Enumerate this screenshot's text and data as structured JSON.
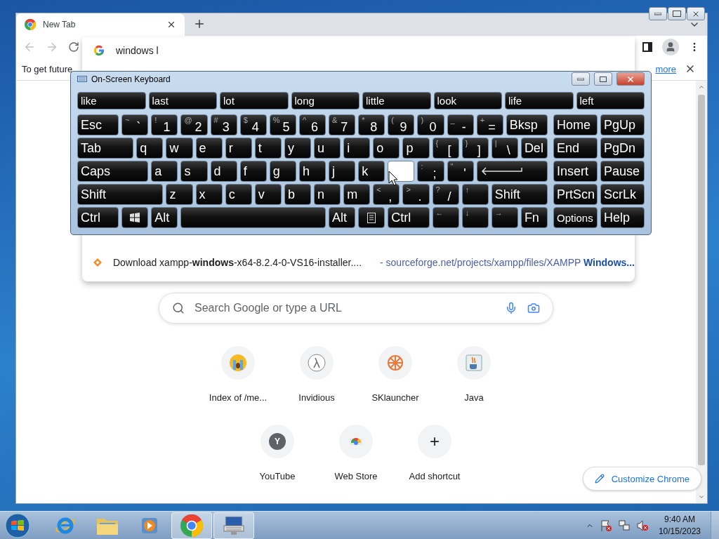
{
  "browser": {
    "tab": {
      "title": "New Tab",
      "selected": true
    },
    "omnibox": {
      "value": "windows l"
    },
    "infobar": {
      "text": "To get future",
      "link": "more"
    },
    "suggestions": [
      {
        "text": "Download xampp-**windows**-x64-8.2.4-0-VS16-installer....",
        "url": "- sourceforge.net/projects/xampp/files/XAMPP **Windows...**"
      }
    ],
    "search": {
      "placeholder": "Search Google or type a URL"
    },
    "shortcuts": [
      {
        "kind": "index",
        "label": "Index of /me..."
      },
      {
        "kind": "invidious",
        "label": "Invidious"
      },
      {
        "kind": "sklauncher",
        "label": "SKlauncher"
      },
      {
        "kind": "java",
        "label": "Java"
      },
      {
        "kind": "letter",
        "glyph": "Y",
        "label": "YouTube"
      },
      {
        "kind": "webstore",
        "label": "Web Store"
      },
      {
        "kind": "letter",
        "glyph": "+",
        "label": "Add shortcut"
      }
    ],
    "customize": "Customize Chrome"
  },
  "keyboard": {
    "title": "On-Screen Keyboard",
    "predictions": [
      "like",
      "last",
      "lot",
      "long",
      "little",
      "look",
      "life",
      "left"
    ],
    "key_rows": [
      {
        "keys": [
          {
            "label": "Esc"
          },
          {
            "top": "~",
            "label": "`"
          },
          {
            "top": "!",
            "label": "1"
          },
          {
            "top": "@",
            "label": "2"
          },
          {
            "top": "#",
            "label": "3"
          },
          {
            "top": "$",
            "label": "4"
          },
          {
            "top": "%",
            "label": "5"
          },
          {
            "top": "^",
            "label": "6"
          },
          {
            "top": "&",
            "label": "7"
          },
          {
            "top": "*",
            "label": "8"
          },
          {
            "top": "(",
            "label": "9"
          },
          {
            "top": ")",
            "label": "0"
          },
          {
            "top": "_",
            "label": "-"
          },
          {
            "top": "+",
            "label": "="
          },
          {
            "label": "Bksp"
          }
        ]
      },
      {
        "keys": [
          {
            "label": "Tab"
          },
          {
            "label": "q"
          },
          {
            "label": "w"
          },
          {
            "label": "e"
          },
          {
            "label": "r"
          },
          {
            "label": "t"
          },
          {
            "label": "y"
          },
          {
            "label": "u"
          },
          {
            "label": "i"
          },
          {
            "label": "o"
          },
          {
            "label": "p"
          },
          {
            "top": "{",
            "label": "["
          },
          {
            "top": "}",
            "label": "]"
          },
          {
            "top": "|",
            "label": "\\"
          },
          {
            "label": "Del"
          }
        ]
      },
      {
        "keys": [
          {
            "label": "Caps"
          },
          {
            "label": "a"
          },
          {
            "label": "s"
          },
          {
            "label": "d"
          },
          {
            "label": "f"
          },
          {
            "label": "g"
          },
          {
            "label": "h"
          },
          {
            "label": "j"
          },
          {
            "label": "k"
          },
          {
            "kind": "blank"
          },
          {
            "top": ":",
            "label": ";"
          },
          {
            "top": "\"",
            "label": "'"
          },
          {
            "kind": "enter"
          }
        ]
      },
      {
        "keys": [
          {
            "label": "Shift"
          },
          {
            "label": "z"
          },
          {
            "label": "x"
          },
          {
            "label": "c"
          },
          {
            "label": "v"
          },
          {
            "label": "b"
          },
          {
            "label": "n"
          },
          {
            "label": "m"
          },
          {
            "top": "<",
            "label": ","
          },
          {
            "top": ">",
            "label": "."
          },
          {
            "top": "?",
            "label": "/"
          },
          {
            "top": "↑"
          },
          {
            "label": "Shift"
          }
        ]
      },
      {
        "keys": [
          {
            "label": "Ctrl"
          },
          {
            "kind": "windows"
          },
          {
            "label": "Alt"
          },
          {
            "kind": "space"
          },
          {
            "label": "Alt"
          },
          {
            "kind": "menu"
          },
          {
            "label": "Ctrl"
          },
          {
            "top": "←"
          },
          {
            "top": "↓"
          },
          {
            "top": "→"
          },
          {
            "label": "Fn"
          }
        ]
      }
    ],
    "side": [
      [
        {
          "label": "Home"
        },
        {
          "label": "PgUp"
        }
      ],
      [
        {
          "label": "End"
        },
        {
          "label": "PgDn"
        }
      ],
      [
        {
          "label": "Insert"
        },
        {
          "label": "Pause"
        }
      ],
      [
        {
          "label": "PrtScn"
        },
        {
          "label": "ScrLk"
        }
      ],
      [
        {
          "label": "Options",
          "kind": "small"
        },
        {
          "label": "Help"
        }
      ]
    ]
  },
  "taskbar": {
    "apps": [
      {
        "kind": "ie",
        "selected": false
      },
      {
        "kind": "explorer",
        "selected": false
      },
      {
        "kind": "media",
        "selected": false
      },
      {
        "kind": "chrome",
        "selected": true
      },
      {
        "kind": "osk",
        "selected": true
      }
    ],
    "time": "9:40 AM",
    "date": "10/15/2023"
  }
}
